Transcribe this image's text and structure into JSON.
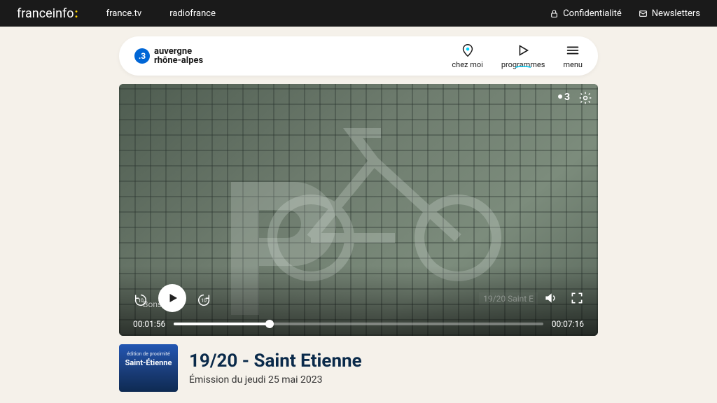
{
  "topbar": {
    "brand_main": "franceinfo",
    "brand_colon": ":",
    "link1": "france.tv",
    "link2": "radiofrance",
    "confidentialite": "Confidentialité",
    "newsletters": "Newsletters"
  },
  "header": {
    "logo_number": ".3",
    "region_line1": "auvergne",
    "region_line2": "rhône-alpes",
    "chez_moi": "chez moi",
    "programmes": "programmes",
    "menu": "menu"
  },
  "player": {
    "elapsed": "00:01:56",
    "total": "00:07:16",
    "caption_left": "Bonson",
    "caption_right": "19/20    Saint E",
    "skip_back": "10",
    "skip_fwd": "10",
    "badge_number": "3"
  },
  "video_info": {
    "thumb_top": "édition de proximité",
    "thumb_title": "Saint-Étienne",
    "title": "19/20 - Saint Etienne",
    "subtitle": "Émission du jeudi 25 mai 2023"
  }
}
